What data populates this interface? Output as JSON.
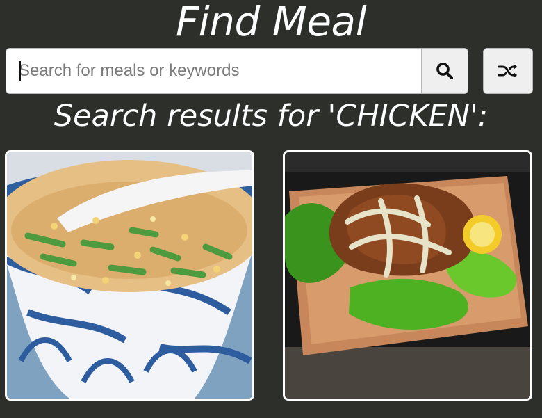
{
  "header": {
    "title": "Find Meal"
  },
  "search": {
    "placeholder": "Search for meals or keywords",
    "value": "",
    "submit_icon": "search-icon",
    "random_icon": "shuffle-icon"
  },
  "results": {
    "heading": "Search results for 'CHICKEN':",
    "meals": [
      {
        "image": "bowl of chicken rice porridge with green onions and fried garlic"
      },
      {
        "image": "fried chicken with creamy sauce on lettuce on a wooden board"
      }
    ]
  },
  "colors": {
    "background": "#2d2f2b",
    "text": "#ffffff",
    "button_bg": "#efefef",
    "input_border": "#b9b9b9"
  }
}
